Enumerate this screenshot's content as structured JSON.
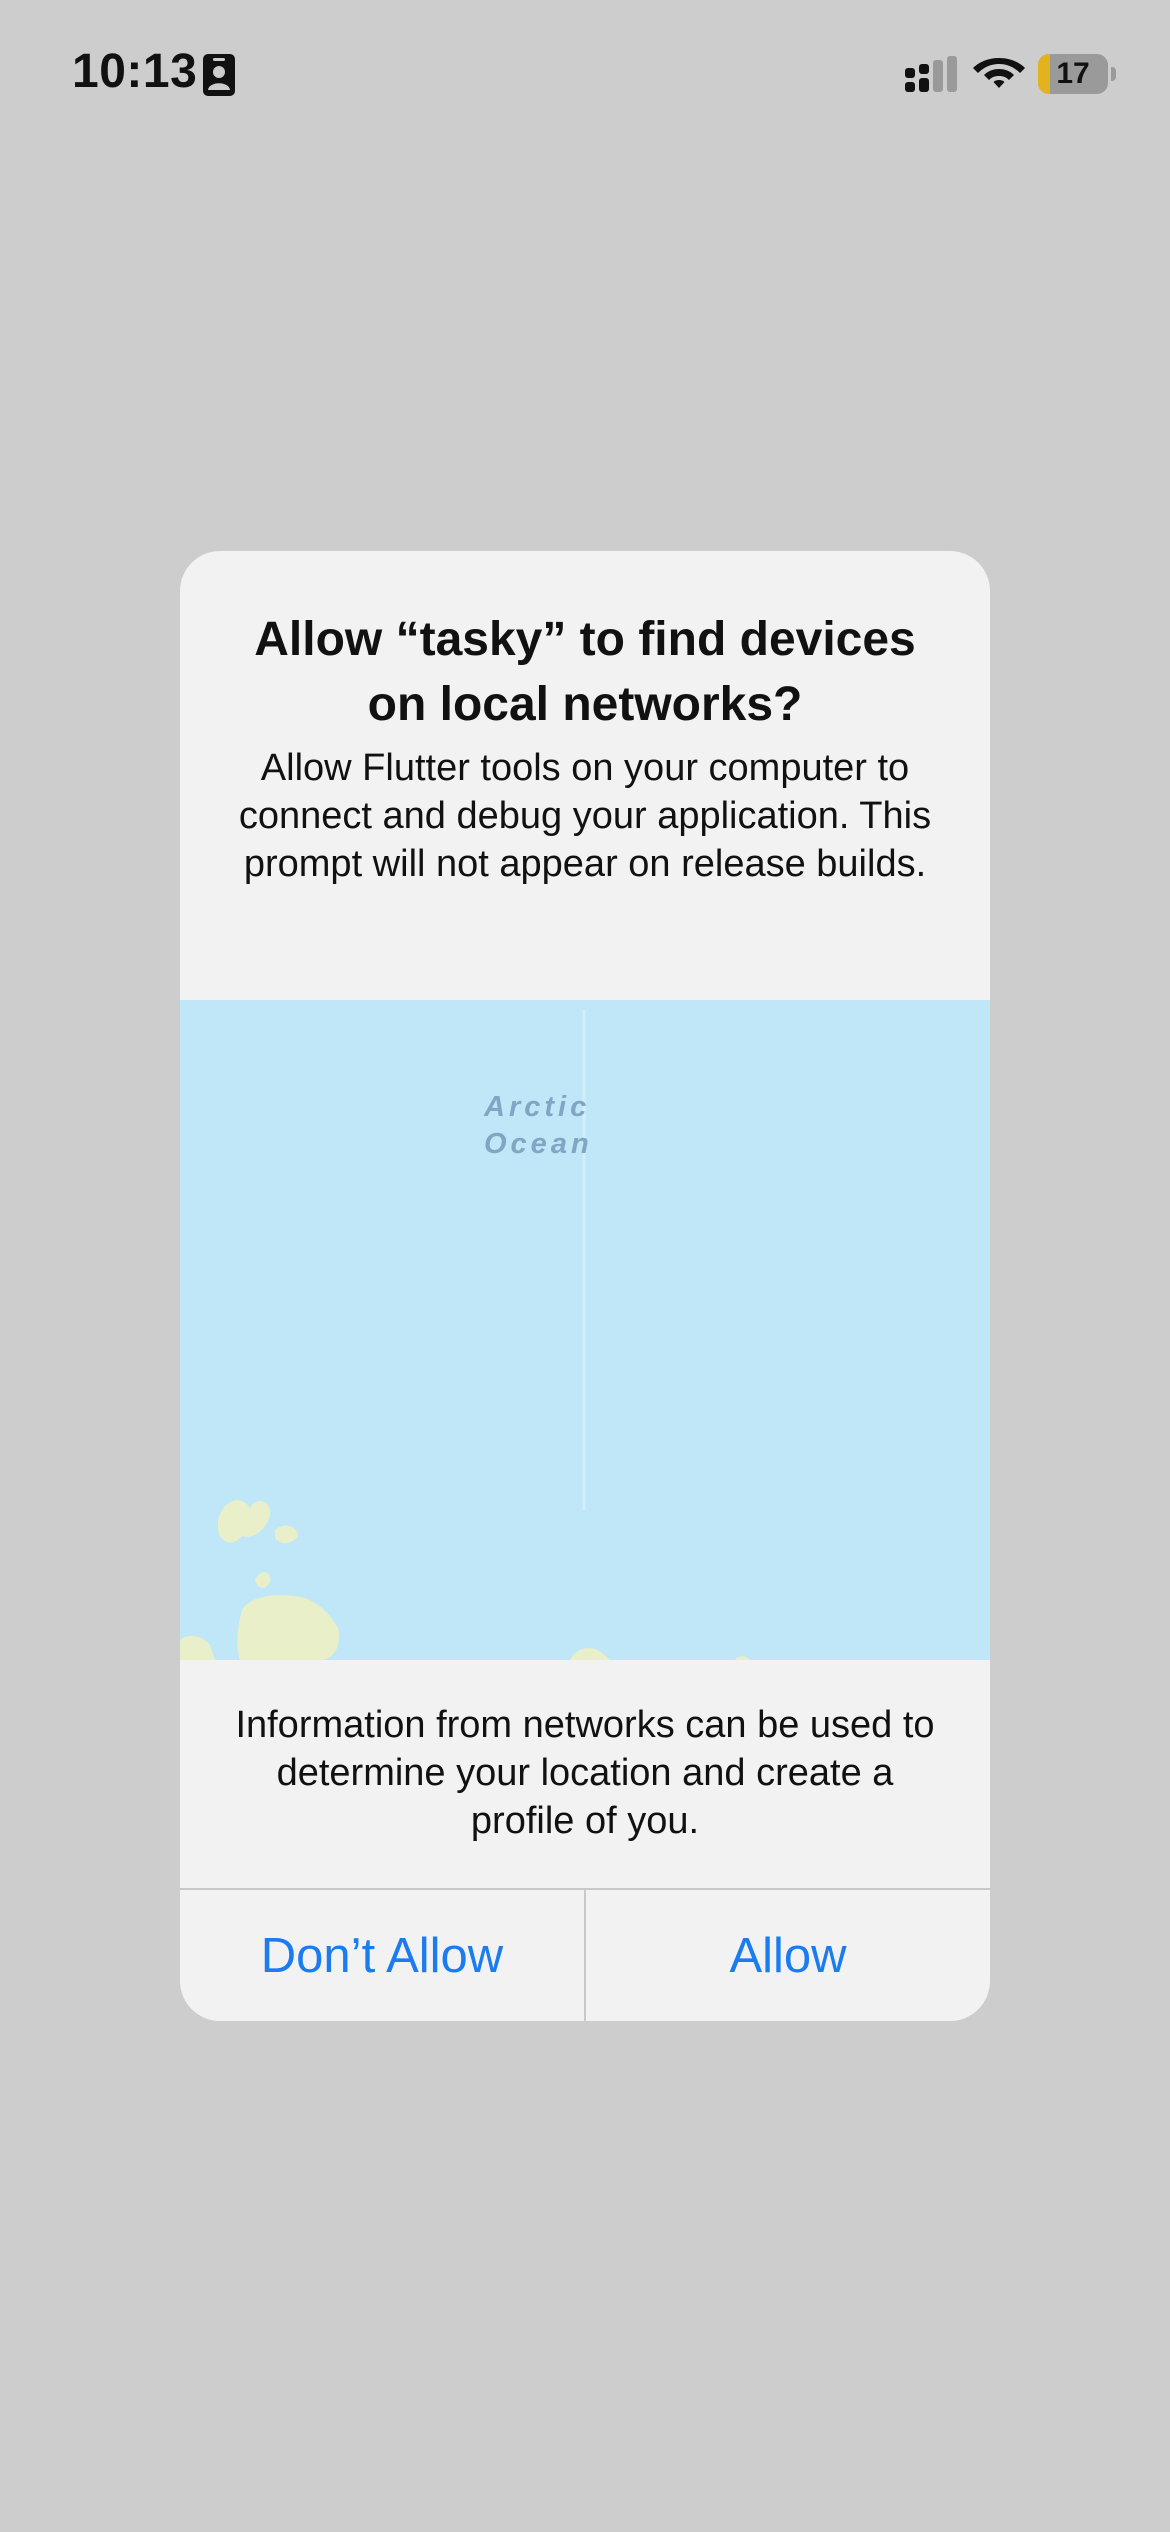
{
  "status_bar": {
    "time": "10:13",
    "battery_level": "17",
    "battery_fraction": 0.17,
    "icons": [
      "contact-card-icon",
      "cellular-signal-icon",
      "wifi-icon",
      "battery-icon"
    ]
  },
  "alert": {
    "title": "Allow “tasky” to find devices on local networks?",
    "message": "Allow Flutter tools on your computer to connect and debug your application. This prompt will not appear on release builds.",
    "map_label": "Arctic Ocean",
    "footer": "Information from networks can be used to determine your location and create a profile of you.",
    "buttons": {
      "deny_label": "Don’t Allow",
      "allow_label": "Allow"
    }
  },
  "colors": {
    "background": "#cdcdcd",
    "alert_background": "#f2f2f2",
    "button_text": "#1b7cf0",
    "map_water": "#bfe7f7",
    "map_land": "#e9efc9",
    "battery_fill": "#e3b21f"
  }
}
